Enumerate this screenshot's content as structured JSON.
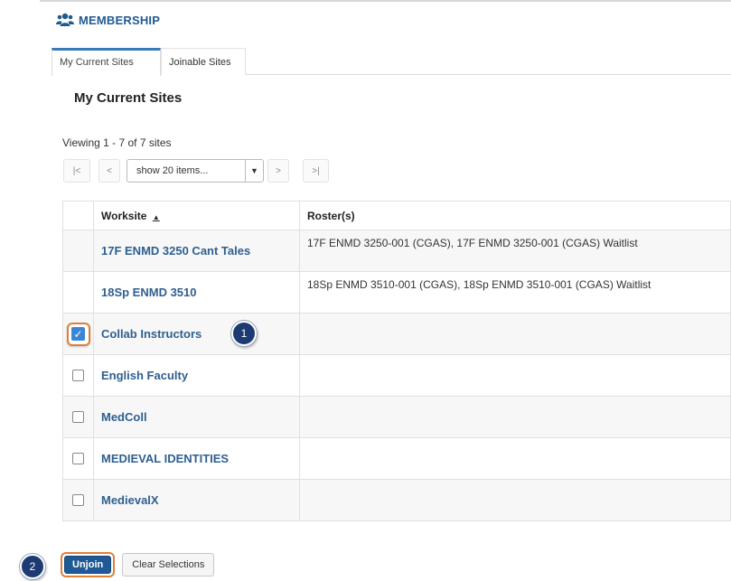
{
  "tool": {
    "title": "MEMBERSHIP",
    "icon": "people-icon"
  },
  "tabs": [
    {
      "label": "My Current Sites",
      "active": true
    },
    {
      "label": "Joinable Sites",
      "active": false
    }
  ],
  "page_title": "My Current Sites",
  "viewing_text": "Viewing 1 - 7 of 7 sites",
  "pager": {
    "first": "|<",
    "prev": "<",
    "page_size": "show 20 items...",
    "next": ">",
    "last": ">|"
  },
  "table": {
    "headers": {
      "worksite": "Worksite",
      "sort_indicator": "▲",
      "rosters": "Roster(s)"
    },
    "rows": [
      {
        "site": "17F ENMD 3250 Cant Tales",
        "rosters": "17F ENMD 3250-001 (CGAS), 17F ENMD 3250-001 (CGAS) Waitlist",
        "checkbox": "none",
        "checked": false
      },
      {
        "site": "18Sp ENMD 3510",
        "rosters": "18Sp ENMD 3510-001 (CGAS), 18Sp ENMD 3510-001 (CGAS) Waitlist",
        "checkbox": "none",
        "checked": false
      },
      {
        "site": "Collab Instructors",
        "rosters": "",
        "checkbox": "yes",
        "checked": true
      },
      {
        "site": "English Faculty",
        "rosters": "",
        "checkbox": "yes",
        "checked": false
      },
      {
        "site": "MedColl",
        "rosters": "",
        "checkbox": "yes",
        "checked": false
      },
      {
        "site": "MEDIEVAL IDENTITIES",
        "rosters": "",
        "checkbox": "yes",
        "checked": false
      },
      {
        "site": "MedievalX",
        "rosters": "",
        "checkbox": "yes",
        "checked": false
      }
    ]
  },
  "callouts": {
    "step1": "1",
    "step2": "2"
  },
  "buttons": {
    "unjoin": "Unjoin",
    "clear": "Clear Selections"
  },
  "colors": {
    "link": "#2f5f8f",
    "primary_button": "#1f5a96",
    "highlight": "#e07f3a",
    "callout": "#1d3a72"
  }
}
